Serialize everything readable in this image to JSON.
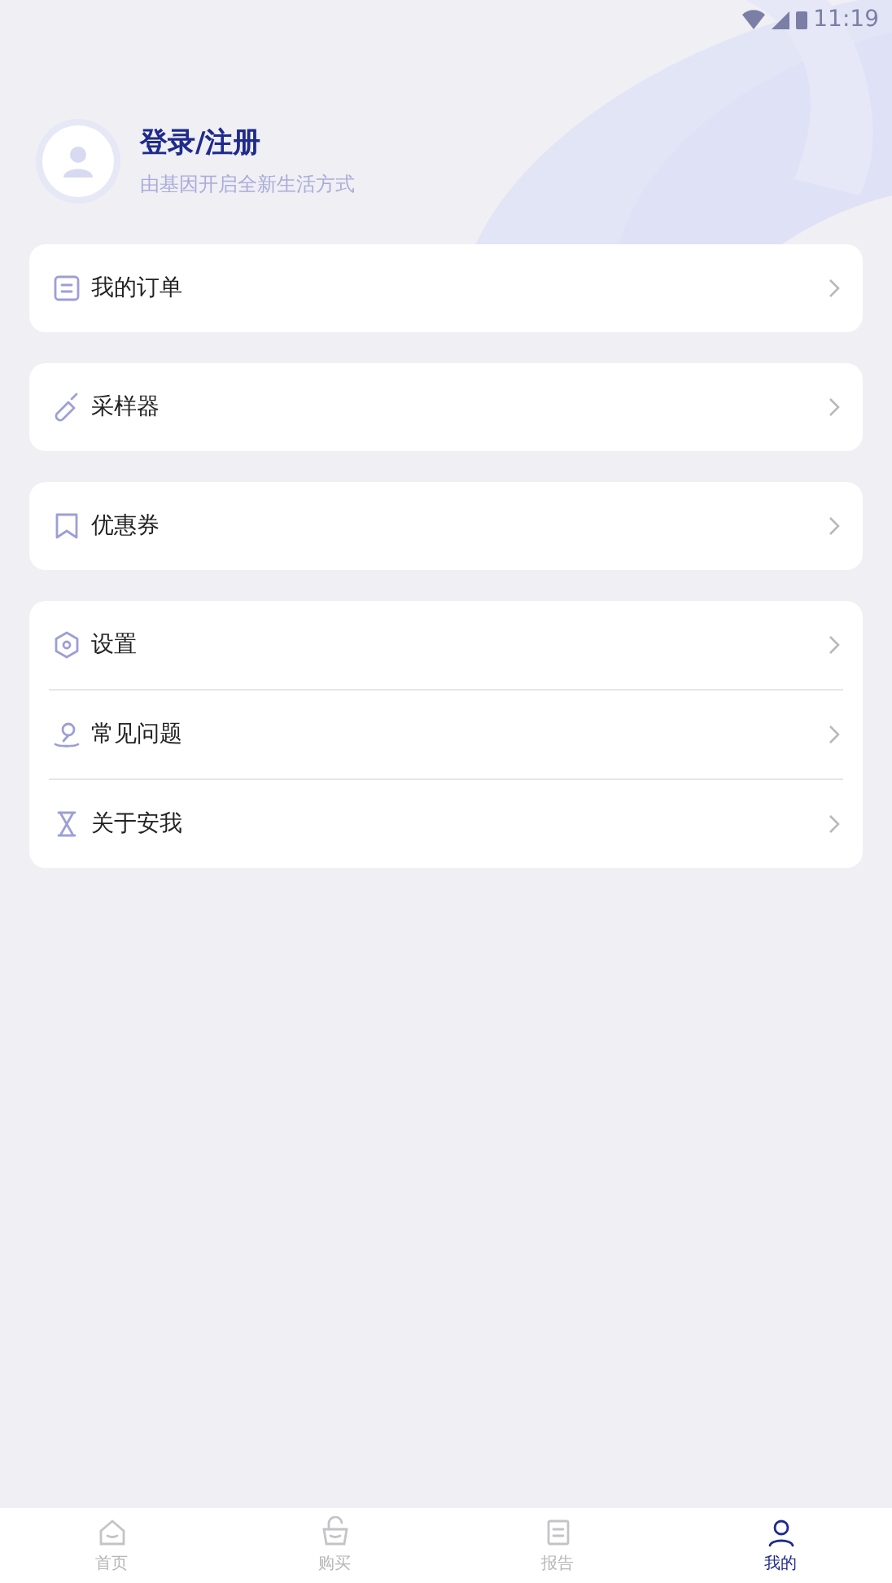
{
  "status_bar": {
    "time": "11:19"
  },
  "profile": {
    "title": "登录/注册",
    "subtitle": "由基因开启全新生活方式"
  },
  "groups": [
    {
      "items": [
        {
          "label": "我的订单",
          "kind": "order"
        }
      ]
    },
    {
      "items": [
        {
          "label": "采样器",
          "kind": "sampler"
        }
      ]
    },
    {
      "items": [
        {
          "label": "优惠券",
          "kind": "coupon"
        }
      ]
    },
    {
      "items": [
        {
          "label": "设置",
          "kind": "settings"
        },
        {
          "label": "常见问题",
          "kind": "faq"
        },
        {
          "label": "关于安我",
          "kind": "about"
        }
      ]
    }
  ],
  "tabs": [
    {
      "label": "首页",
      "kind": "home",
      "selected": false
    },
    {
      "label": "购买",
      "kind": "buy",
      "selected": false
    },
    {
      "label": "报告",
      "kind": "report",
      "selected": false
    },
    {
      "label": "我的",
      "kind": "me",
      "selected": true
    }
  ]
}
